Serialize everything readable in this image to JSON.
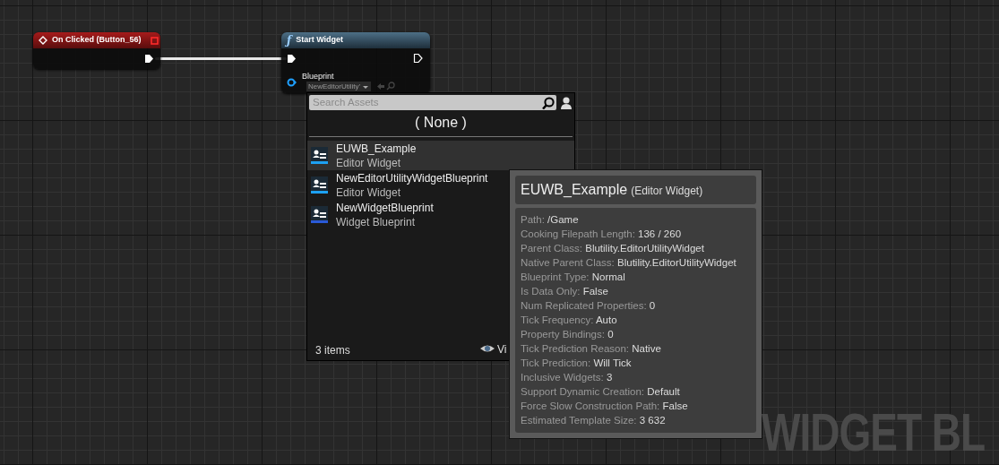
{
  "graph_label": "WIDGET BL",
  "nodes": [
    {
      "kind": "event",
      "title": "On Clicked (Button_56)"
    },
    {
      "kind": "function",
      "icon": "ƒ",
      "title": "Start Widget",
      "pin_label": "Blueprint",
      "pin_value": "NewEditorUtility'"
    }
  ],
  "asset_picker": {
    "search": {
      "placeholder": "Search Assets"
    },
    "none_label": "( None )",
    "items": [
      {
        "name": "EUWB_Example",
        "type": "Editor Widget",
        "selected": true
      },
      {
        "name": "NewEditorUtilityWidgetBlueprint",
        "type": "Editor Widget",
        "selected": false
      },
      {
        "name": "NewWidgetBlueprint",
        "type": "Widget Blueprint",
        "selected": false
      }
    ],
    "count": "3 items",
    "view_label": "Vi"
  },
  "tooltip": {
    "title": "EUWB_Example",
    "subtitle": "(Editor Widget)",
    "rows": [
      {
        "label": "Path:",
        "value": "/Game"
      },
      {
        "label": "Cooking Filepath Length:",
        "value": "136 / 260"
      },
      {
        "label": "Parent Class:",
        "value": "Blutility.EditorUtilityWidget"
      },
      {
        "label": "Native Parent Class:",
        "value": "Blutility.EditorUtilityWidget"
      },
      {
        "label": "Blueprint Type:",
        "value": "Normal"
      },
      {
        "label": "Is Data Only:",
        "value": "False"
      },
      {
        "label": "Num Replicated Properties:",
        "value": "0"
      },
      {
        "label": "Tick Frequency:",
        "value": "Auto"
      },
      {
        "label": "Property Bindings:",
        "value": "0"
      },
      {
        "label": "Tick Prediction Reason:",
        "value": "Native"
      },
      {
        "label": "Tick Prediction:",
        "value": "Will Tick"
      },
      {
        "label": "Inclusive Widgets:",
        "value": "3"
      },
      {
        "label": "Support Dynamic Creation:",
        "value": "Default"
      },
      {
        "label": "Force Slow Construction Path:",
        "value": "False"
      },
      {
        "label": "Estimated Template Size:",
        "value": "3 632"
      }
    ]
  }
}
